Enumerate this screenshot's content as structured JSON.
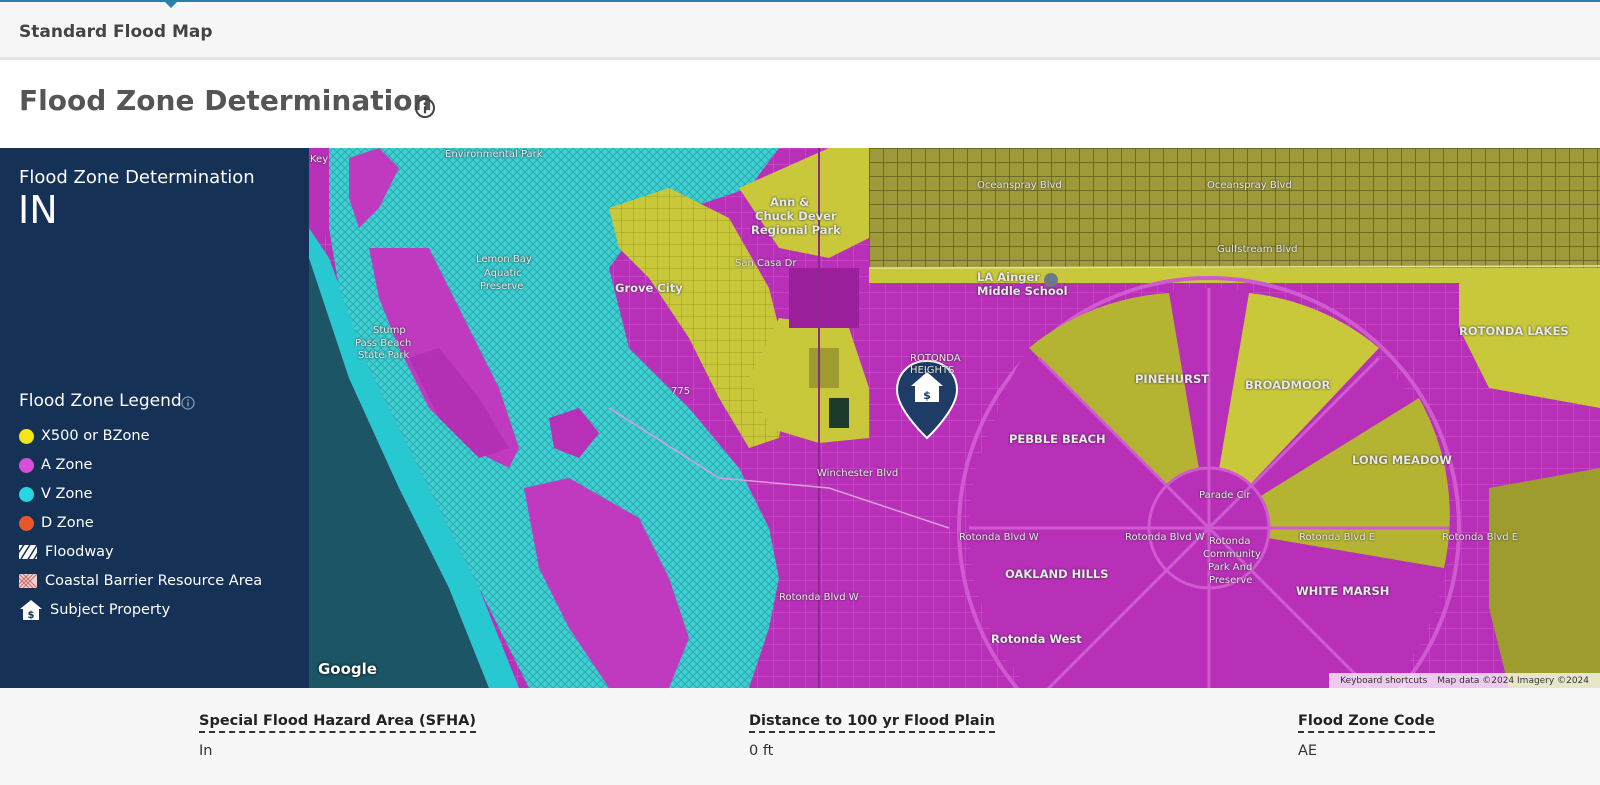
{
  "header": {
    "tab_title": "Standard Flood Map"
  },
  "page": {
    "title": "Flood Zone Determination"
  },
  "panel": {
    "determination_label": "Flood Zone Determination",
    "determination_value": "IN",
    "legend_title": "Flood Zone Legend",
    "legend": [
      {
        "label": "X500 or BZone",
        "color": "#f2e617",
        "icon": "dot"
      },
      {
        "label": "A Zone",
        "color": "#d64fd6",
        "icon": "dot"
      },
      {
        "label": "V Zone",
        "color": "#27d6e0",
        "icon": "dot"
      },
      {
        "label": "D Zone",
        "color": "#e8572a",
        "icon": "dot"
      },
      {
        "label": "Floodway",
        "color": "#ffffff",
        "icon": "hatch-square"
      },
      {
        "label": "Coastal Barrier Resource Area",
        "color": "#e8b4b4",
        "icon": "crosshatch-square"
      },
      {
        "label": "Subject Property",
        "color": "#ffffff",
        "icon": "house-icon"
      }
    ]
  },
  "map": {
    "labels": {
      "environmental_park": "Environmental Park",
      "key": "Key",
      "ann_chuck": "Ann &",
      "chuck_dever": "Chuck Dever",
      "regional_park": "Regional Park",
      "lemon_bay": "Lemon Bay",
      "aquatic": "Aquatic",
      "preserve": "Preserve",
      "grove_city": "Grove City",
      "la_ainger": "LA Ainger",
      "middle_school": "Middle School",
      "stump_pass": "Stump",
      "pass_beach": "Pass Beach",
      "state_park": "State Park",
      "rotonda": "ROTONDA",
      "heights": "HEIGHTS",
      "pinehurst": "PINEHURST",
      "broadmoor": "BROADMOOR",
      "rotonda_lakes": "ROTONDA LAKES",
      "pebble_beach": "PEBBLE BEACH",
      "long_meadow": "LONG MEADOW",
      "oakland_hills": "OAKLAND HILLS",
      "white_marsh": "WHITE MARSH",
      "rotonda_west": "Rotonda West",
      "rotonda_community": "Rotonda",
      "community": "Community",
      "park_and": "Park And",
      "preserve2": "Preserve",
      "rotonda_blvd_w1": "Rotonda Blvd W",
      "rotonda_blvd_w2": "Rotonda Blvd W",
      "rotonda_blvd_e": "Rotonda Blvd E",
      "rotonda_blvd_e2": "Rotonda Blvd E",
      "oceanspray": "Oceanspray Blvd",
      "oceanspray2": "Oceanspray Blvd",
      "gulfstream": "Gulfstream Blvd",
      "san_casa": "San Casa Dr",
      "winchester": "Winchester Blvd",
      "rotonda_blvd_w3": "Rotonda Blvd W",
      "parade_cir": "Parade Cir",
      "road_775": "775"
    },
    "google_logo": "Google",
    "attribution": {
      "shortcuts": "Keyboard shortcuts",
      "data": "Map data ©2024 Imagery ©2024"
    },
    "colors": {
      "a_zone": "#b82fb8",
      "x500": "#c8c83a",
      "v_zone": "#3ecfd2",
      "water": "#1e5a6e"
    }
  },
  "facts": [
    {
      "label": "Special Flood Hazard Area (SFHA)",
      "value": "In"
    },
    {
      "label": "Distance to 100 yr Flood Plain",
      "value": "0 ft"
    },
    {
      "label": "Flood Zone Code",
      "value": "AE"
    }
  ]
}
